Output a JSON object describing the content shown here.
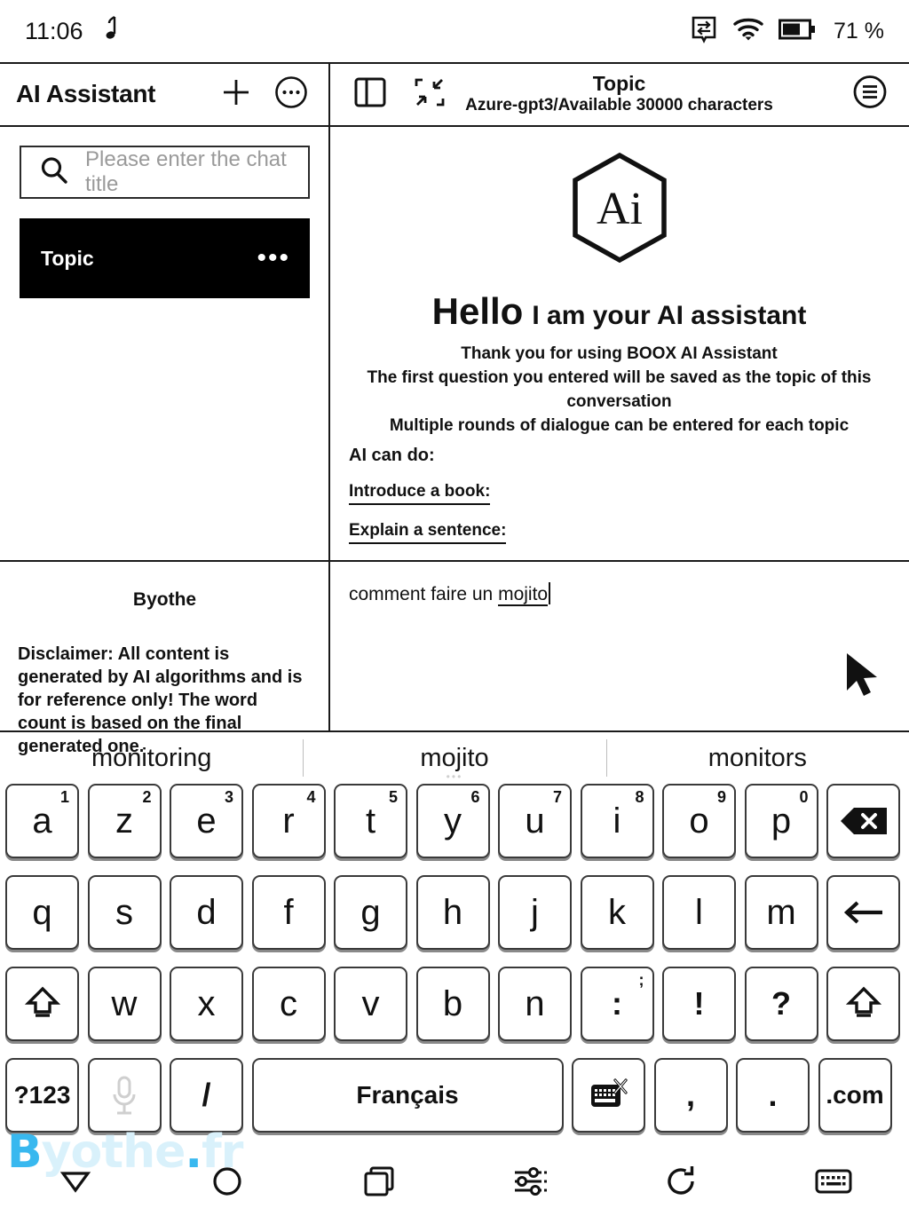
{
  "status_bar": {
    "time": "11:06",
    "music_icon": "music-note-icon",
    "sync_icon": "sync-transfer-icon",
    "wifi_icon": "wifi-icon",
    "battery_icon": "battery-icon",
    "battery_percent": "71 %"
  },
  "toolbar": {
    "app_title": "AI Assistant",
    "add_label": "+",
    "more_icon": "more-circle-icon",
    "split_view_icon": "split-panel-icon",
    "fullscreen_icon": "collapse-fullscreen-icon",
    "topic_title": "Topic",
    "topic_subtitle": "Azure-gpt3/Available 30000 characters",
    "menu_icon": "list-menu-circle-icon"
  },
  "sidebar": {
    "search_placeholder": "Please enter the chat title",
    "search_icon": "search-icon",
    "items": [
      {
        "label": "Topic",
        "more": "•••",
        "selected": true
      }
    ]
  },
  "chat": {
    "logo_text": "Ai",
    "hello_bold": "Hello",
    "hello_rest": "I am your AI assistant",
    "blurb_line1": "Thank you for using BOOX AI Assistant",
    "blurb_line2": "The first question you entered will be saved as the topic of this conversation",
    "blurb_line3": "Multiple rounds of dialogue can be entered for each topic",
    "can_do_heading": "AI can do:",
    "can_do_items": [
      "Introduce a book:",
      "Explain a sentence:"
    ]
  },
  "disclaimer_panel": {
    "author": "Byothe",
    "text": "Disclaimer: All content is generated by AI algorithms and is for reference only! The word count is based on the final generated one."
  },
  "input_panel": {
    "text_before": "comment faire un ",
    "text_misspelled": "mojito",
    "cursor_icon": "mouse-pointer-icon"
  },
  "suggestions": [
    {
      "word": "monitoring",
      "dots": ""
    },
    {
      "word": "mojito",
      "dots": "•••"
    },
    {
      "word": "monitors",
      "dots": ""
    }
  ],
  "keyboard": {
    "row1": [
      {
        "label": "a",
        "sup": "1"
      },
      {
        "label": "z",
        "sup": "2"
      },
      {
        "label": "e",
        "sup": "3"
      },
      {
        "label": "r",
        "sup": "4"
      },
      {
        "label": "t",
        "sup": "5"
      },
      {
        "label": "y",
        "sup": "6"
      },
      {
        "label": "u",
        "sup": "7"
      },
      {
        "label": "i",
        "sup": "8"
      },
      {
        "label": "o",
        "sup": "9"
      },
      {
        "label": "p",
        "sup": "0"
      },
      {
        "label": "",
        "sup": "",
        "icon": "backspace-icon"
      }
    ],
    "row2": [
      {
        "label": "q"
      },
      {
        "label": "s"
      },
      {
        "label": "d"
      },
      {
        "label": "f"
      },
      {
        "label": "g"
      },
      {
        "label": "h"
      },
      {
        "label": "j"
      },
      {
        "label": "k"
      },
      {
        "label": "l"
      },
      {
        "label": "m"
      },
      {
        "label": "",
        "icon": "enter-return-icon"
      }
    ],
    "row3": [
      {
        "label": "",
        "icon": "shift-up-arrow-icon"
      },
      {
        "label": "w"
      },
      {
        "label": "x"
      },
      {
        "label": "c"
      },
      {
        "label": "v"
      },
      {
        "label": "b"
      },
      {
        "label": "n"
      },
      {
        "label": ":",
        "sup": ";"
      },
      {
        "label": "!"
      },
      {
        "label": "?"
      },
      {
        "label": "",
        "icon": "shift-up-arrow-icon"
      }
    ],
    "row4": [
      {
        "label": "?123"
      },
      {
        "label": "",
        "icon": "microphone-icon"
      },
      {
        "label": "/"
      },
      {
        "label": "Français"
      },
      {
        "label": "",
        "icon": "keyboard-switch-icon"
      },
      {
        "label": ","
      },
      {
        "label": "."
      },
      {
        "label": ".com"
      }
    ]
  },
  "watermark": {
    "b": "B",
    "rest": "yothe",
    "dot": ".",
    "tld": "fr"
  },
  "navbar": [
    {
      "icon": "back-triangle-icon"
    },
    {
      "icon": "home-circle-icon"
    },
    {
      "icon": "recents-squares-icon"
    },
    {
      "icon": "settings-sliders-icon"
    },
    {
      "icon": "refresh-icon"
    },
    {
      "icon": "keyboard-icon"
    }
  ]
}
